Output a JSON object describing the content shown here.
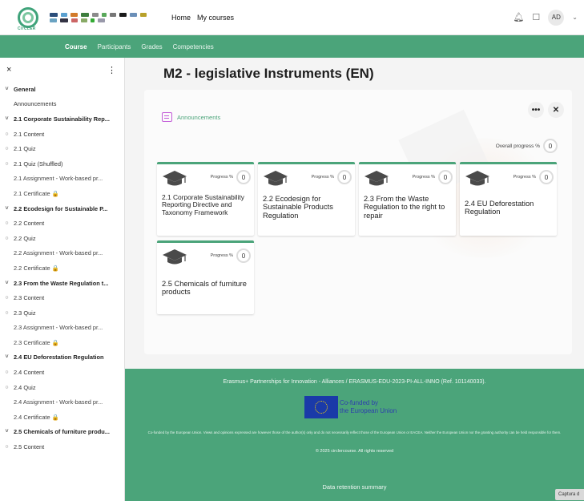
{
  "header": {
    "logo_text": "CirCLER",
    "nav": [
      "Home",
      "My courses"
    ],
    "avatar": "AD",
    "bell_icon": "bell-icon",
    "chat_icon": "chat-icon"
  },
  "subnav": {
    "items": [
      "Course",
      "Participants",
      "Grades",
      "Competencies"
    ]
  },
  "drawer": {
    "close": "×",
    "more": "⋮",
    "items": [
      {
        "label": "General",
        "type": "section"
      },
      {
        "label": "Announcements",
        "type": "lead"
      },
      {
        "label": "2.1 Corporate Sustainability Rep...",
        "type": "section"
      },
      {
        "label": "2.1 Content",
        "type": "activity"
      },
      {
        "label": "2.1 Quiz",
        "type": "activity"
      },
      {
        "label": "2.1 Quiz (Shuffled)",
        "type": "activity"
      },
      {
        "label": "2.1 Assignment - Work-based pr...",
        "type": "sub"
      },
      {
        "label": "2.1 Certificate 🔒",
        "type": "sub"
      },
      {
        "label": "2.2 Ecodesign for Sustainable P...",
        "type": "section"
      },
      {
        "label": "2.2 Content",
        "type": "activity"
      },
      {
        "label": "2.2 Quiz",
        "type": "activity"
      },
      {
        "label": "2.2 Assignment - Work-based pr...",
        "type": "sub"
      },
      {
        "label": "2.2 Certificate 🔒",
        "type": "sub"
      },
      {
        "label": "2.3 From the Waste Regulation t...",
        "type": "section"
      },
      {
        "label": "2.3 Content",
        "type": "activity"
      },
      {
        "label": "2.3 Quiz",
        "type": "activity"
      },
      {
        "label": "2.3 Assignment - Work-based pr...",
        "type": "sub"
      },
      {
        "label": "2.3 Certificate 🔒",
        "type": "sub"
      },
      {
        "label": "2.4 EU Deforestation Regulation",
        "type": "section"
      },
      {
        "label": "2.4 Content",
        "type": "activity"
      },
      {
        "label": "2.4 Quiz",
        "type": "activity"
      },
      {
        "label": "2.4 Assignment - Work-based pr...",
        "type": "sub"
      },
      {
        "label": "2.4 Certificate 🔒",
        "type": "sub"
      },
      {
        "label": "2.5 Chemicals of furniture produ...",
        "type": "section"
      },
      {
        "label": "2.5 Content",
        "type": "activity"
      }
    ]
  },
  "main": {
    "title": "M2 - legislative Instruments (EN)",
    "announcements": "Announcements",
    "more_label": "•••",
    "close_label": "✕",
    "overall_label": "Overall progress %",
    "overall_value": "0",
    "progress_label": "Progress %",
    "cards": [
      {
        "title": "2.1 Corporate Sustainability Reporting Directive and Taxonomy Framework",
        "progress": "0",
        "size": "small"
      },
      {
        "title": "2.2 Ecodesign for Sustainable Products Regulation",
        "progress": "0",
        "size": "normal"
      },
      {
        "title": "2.3 From the Waste Regulation to the right to repair",
        "progress": "0",
        "size": "normal"
      },
      {
        "title": "2.4 EU Deforestation Regulation",
        "progress": "0",
        "size": "normal"
      },
      {
        "title": "2.5 Chemicals of furniture products",
        "progress": "0",
        "size": "normal"
      }
    ]
  },
  "footer": {
    "line1": "Erasmus+ Partnerships for Innovation - Alliances / ERASMUS-EDU-2023-PI-ALL-INNO (Ref. 101140033).",
    "eu_line1": "Co-funded by",
    "eu_line2": "the European Union",
    "disclaimer": "Co-funded by the European Union. Views and opinions expressed are however those of the author(s) only and do not necessarily reflect those of the European Union or EACEA. Neither the European Union nor the granting authority can be held responsible for them.",
    "rights": "© 2025 circlercourse. All rights reserved",
    "retention": "Data retention summary"
  },
  "captura": "Captura d",
  "colors": {
    "accent": "#4ba47a",
    "eu_blue": "#1a3aa8"
  }
}
